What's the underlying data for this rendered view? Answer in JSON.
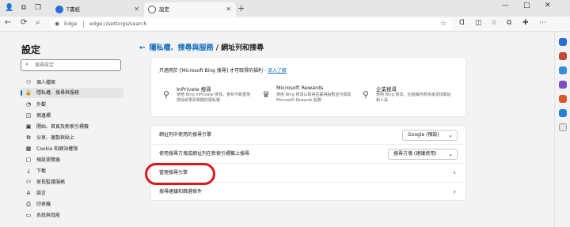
{
  "browser": {
    "tabs": [
      {
        "label": "T書紙"
      },
      {
        "label": "設定"
      }
    ],
    "new_tab": "+",
    "window_controls": [
      "—",
      "□",
      "✕"
    ],
    "address": {
      "brand": "Edge",
      "url": "edge://settings/search"
    }
  },
  "sidebar": {
    "title": "設定",
    "search_placeholder": "搜尋設定",
    "items": [
      {
        "label": "個人檔案",
        "icon": "person-icon"
      },
      {
        "label": "隱私權、搜尋與服務",
        "icon": "lock-icon",
        "active": true
      },
      {
        "label": "外觀",
        "icon": "palette-icon"
      },
      {
        "label": "側邊欄",
        "icon": "sidebar-icon"
      },
      {
        "label": "開始、首頁及新索引標籤",
        "icon": "home-icon"
      },
      {
        "label": "分享、複製與貼上",
        "icon": "share-icon"
      },
      {
        "label": "Cookie 和網站權限",
        "icon": "cookie-icon"
      },
      {
        "label": "預設瀏覽器",
        "icon": "browser-icon"
      },
      {
        "label": "下載",
        "icon": "download-icon"
      },
      {
        "label": "家長監護服務",
        "icon": "family-icon"
      },
      {
        "label": "語言",
        "icon": "language-icon"
      },
      {
        "label": "印表機",
        "icon": "printer-icon"
      },
      {
        "label": "系統與效能",
        "icon": "system-icon"
      }
    ]
  },
  "main": {
    "breadcrumb": {
      "parent": "隱私權、搜尋與服務",
      "separator": "/",
      "current": "網址列和搜尋"
    },
    "bing_card": {
      "intro": "只適用於 [Microsoft Bing 搜尋] 才可取得的福利 -",
      "learn_more": "深入了解",
      "features": [
        {
          "title": "InPrivate 搜尋",
          "desc": "使用 Bing InPrivate 搜尋，會有不斷重現搜尋結果與相關的隱私權",
          "icon": "inprivate-icon"
        },
        {
          "title": "Microsoft Rewards",
          "desc": "使用 Bing 搜尋以取得並贏得點數並可換取 Microsoft Rewards 點數",
          "icon": "rewards-icon"
        },
        {
          "title": "企業搜尋",
          "desc": "使用 Bing 搜尋，在組織內部快速尋找網站和人員",
          "icon": "enterprise-icon"
        }
      ]
    },
    "settings_rows": [
      {
        "label": "網址列中使用的搜尋引擎",
        "value": "Google (預設)"
      },
      {
        "label": "使用搜尋方塊或網址列在新索引標籤上搜尋",
        "value": "搜尋方塊 (建議使用)"
      },
      {
        "label": "管理搜尋引擎"
      },
      {
        "label": "搜尋建議和篩選條件"
      }
    ]
  },
  "colors": {
    "accent": "#0f6cbd",
    "highlight": "#e0161c"
  }
}
